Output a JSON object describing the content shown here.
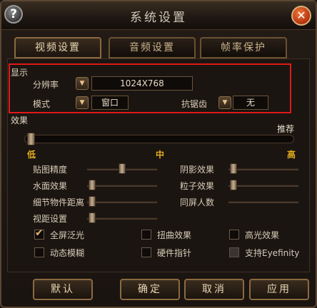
{
  "window": {
    "title": "系统设置"
  },
  "tabs": [
    {
      "label": "视频设置",
      "active": true
    },
    {
      "label": "音频设置",
      "active": false
    },
    {
      "label": "帧率保护",
      "active": false
    }
  ],
  "display": {
    "section_label": "显示",
    "resolution_label": "分辨率",
    "resolution_value": "1024X768",
    "mode_label": "模式",
    "mode_value": "窗口",
    "antialias_label": "抗锯齿",
    "antialias_value": "无"
  },
  "effects": {
    "section_label": "效果",
    "recommended_label": "推荐",
    "low_label": "低",
    "mid_label": "中",
    "high_label": "高",
    "sliders": [
      {
        "label": "贴图精度"
      },
      {
        "label": "阴影效果"
      },
      {
        "label": "水面效果"
      },
      {
        "label": "粒子效果"
      },
      {
        "label": "细节物件距离"
      },
      {
        "label": "同屏人数"
      },
      {
        "label": "视距设置"
      }
    ],
    "checkboxes": [
      {
        "label": "全屏泛光",
        "checked": true
      },
      {
        "label": "扭曲效果",
        "checked": false
      },
      {
        "label": "高光效果",
        "checked": false
      },
      {
        "label": "动态模糊",
        "checked": false
      },
      {
        "label": "硬件指针",
        "checked": false
      },
      {
        "label": "支持Eyefinity",
        "checked": false,
        "disabled": true
      }
    ]
  },
  "buttons": {
    "default": "默认",
    "ok": "确定",
    "cancel": "取消",
    "apply": "应用"
  },
  "icons": {
    "help": "question-icon",
    "close": "close-icon",
    "dropdown": "triangle-down-icon"
  },
  "colors": {
    "highlight_box": "#e11818",
    "level_text": "#e6b020"
  }
}
